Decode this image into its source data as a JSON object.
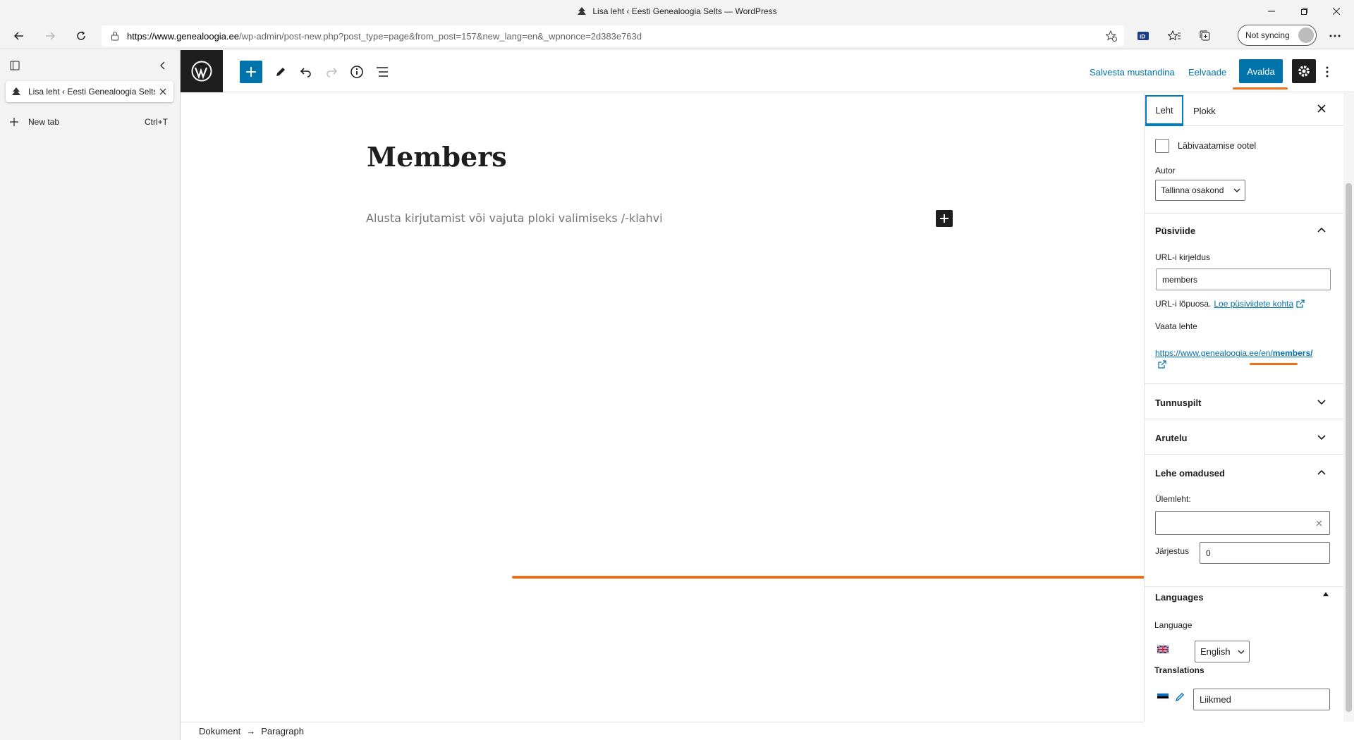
{
  "browser": {
    "window_title": "Lisa leht ‹ Eesti Genealoogia Selts — WordPress",
    "url_domain": "https://www.genealoogia.ee",
    "url_rest": "/wp-admin/post-new.php?post_type=page&from_post=157&new_lang=en&_wpnonce=2d383e763d",
    "sync_label": "Not syncing",
    "tab_title": "Lisa leht ‹ Eesti Genealoogia Selts",
    "new_tab_label": "New tab",
    "new_tab_shortcut": "Ctrl+T"
  },
  "header": {
    "save_draft": "Salvesta mustandina",
    "preview": "Eelvaade",
    "publish": "Avalda"
  },
  "editor": {
    "title": "Members",
    "placeholder": "Alusta kirjutamist või vajuta ploki valimiseks /-klahvi"
  },
  "footer": {
    "crumb_1": "Dokument",
    "arrow": "→",
    "crumb_2": "Paragraph"
  },
  "sidebar": {
    "tab_page": "Leht",
    "tab_block": "Plokk",
    "pending_review": "Läbivaatamise ootel",
    "author_label": "Autor",
    "author_value": "Tallinna osakond",
    "permalink": {
      "title": "Püsiviide",
      "slug_label": "URL-i kirjeldus",
      "slug_value": "members",
      "help_text": "URL-i lõpuosa.",
      "help_link": "Loe püsiviidete kohta",
      "view_label": "Vaata lehte",
      "url_base": "https://www.genealoogia.ee/en/",
      "url_slug": "members/"
    },
    "featured_image": "Tunnuspilt",
    "discussion": "Arutelu",
    "page_attributes": {
      "title": "Lehe omadused",
      "parent_label": "Ülemleht:",
      "parent_value": "",
      "order_label": "Järjestus",
      "order_value": "0"
    },
    "languages": {
      "title": "Languages",
      "language_label": "Language",
      "language_value": "English",
      "translations_label": "Translations",
      "translation_value": "Liikmed"
    }
  },
  "colors": {
    "accent": "#0073aa",
    "highlight": "#f07019",
    "dark": "#1e1e1e"
  }
}
